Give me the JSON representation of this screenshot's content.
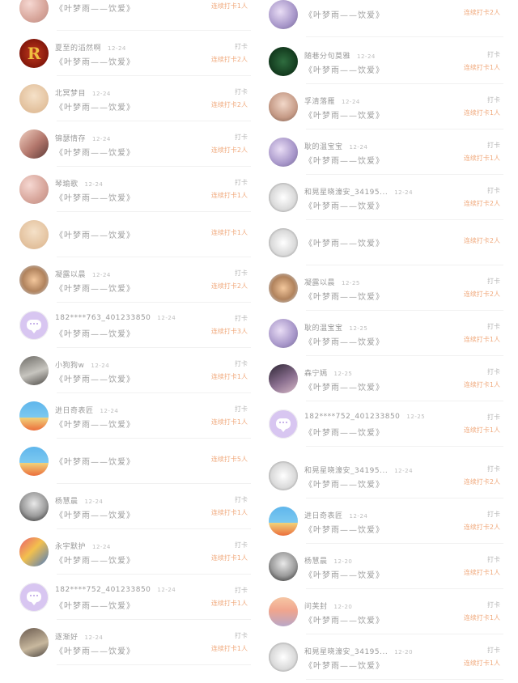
{
  "common": {
    "check_in_label": "打卡"
  },
  "left": [
    {
      "name": "",
      "date": "",
      "title": "《叶梦雨——饮爱》",
      "streak": "连续打卡1人",
      "avatar": "photo-pink",
      "partial": true
    },
    {
      "name": "夏至的滔然啊",
      "date": "12-24",
      "title": "《叶梦雨——饮爱》",
      "streak": "连续打卡2人",
      "avatar": "r-logo"
    },
    {
      "name": "北冥梦目",
      "date": "12-24",
      "title": "《叶梦雨——饮爱》",
      "streak": "连续打卡2人",
      "avatar": "cartoon"
    },
    {
      "name": "锦瑟情存",
      "date": "12-24",
      "title": "《叶梦雨——饮爱》",
      "streak": "连续打卡2人",
      "avatar": "photo-girl"
    },
    {
      "name": "琴瑜歌",
      "date": "12-24",
      "title": "《叶梦雨——饮爱》",
      "streak": "连续打卡1人",
      "avatar": "photo-pink"
    },
    {
      "name": "",
      "date": "",
      "title": "《叶梦雨——饮爱》",
      "streak": "连续打卡1人",
      "avatar": "cartoon",
      "single": true
    },
    {
      "name": "凝露以晨",
      "date": "12-24",
      "title": "《叶梦雨——饮爱》",
      "streak": "连续打卡2人",
      "avatar": "shell"
    },
    {
      "name": "182****763_401233850",
      "date": "12-24",
      "title": "《叶梦雨——饮爱》",
      "streak": "连续打卡3人",
      "avatar": "chat"
    },
    {
      "name": "小狗狗w",
      "date": "12-24",
      "title": "《叶梦雨——饮爱》",
      "streak": "连续打卡1人",
      "avatar": "photo-dog"
    },
    {
      "name": "进日奇表匠",
      "date": "12-24",
      "title": "《叶梦雨——饮爱》",
      "streak": "连续打卡1人",
      "avatar": "poster"
    },
    {
      "name": "",
      "date": "",
      "title": "《叶梦雨——饮爱》",
      "streak": "连续打卡5人",
      "avatar": "poster",
      "single": true
    },
    {
      "name": "杨慧晨",
      "date": "12-24",
      "title": "《叶梦雨——饮爱》",
      "streak": "连续打卡1人",
      "avatar": "bw-face"
    },
    {
      "name": "永宇默护",
      "date": "12-24",
      "title": "《叶梦雨——饮爱》",
      "streak": "连续打卡1人",
      "avatar": "photo-colorful"
    },
    {
      "name": "182****752_401233850",
      "date": "12-24",
      "title": "《叶梦雨——饮爱》",
      "streak": "连续打卡1人",
      "avatar": "chat"
    },
    {
      "name": "逐渐好",
      "date": "12-24",
      "title": "《叶梦雨——饮爱》",
      "streak": "连续打卡1人",
      "avatar": "photo-street"
    }
  ],
  "right": [
    {
      "name": "",
      "date": "",
      "title": "《叶梦雨——饮爱》",
      "streak": "连续打卡2人",
      "avatar": "photo-purple",
      "partial": true
    },
    {
      "name": "随巷分句莫雅",
      "date": "12-24",
      "title": "《叶梦雨——饮爱》",
      "streak": "连续打卡1人",
      "avatar": "green-dark"
    },
    {
      "name": "孚清落雁",
      "date": "12-24",
      "title": "《叶梦雨——饮爱》",
      "streak": "连续打卡1人",
      "avatar": "photo-girl2"
    },
    {
      "name": "耿的温宝宝",
      "date": "12-24",
      "title": "《叶梦雨——饮爱》",
      "streak": "连续打卡1人",
      "avatar": "photo-purple"
    },
    {
      "name": "和晃星晓濠安_34195...",
      "date": "12-24",
      "title": "《叶梦雨——饮爱》",
      "streak": "连续打卡2人",
      "avatar": "sketch"
    },
    {
      "name": "",
      "date": "",
      "title": "《叶梦雨——饮爱》",
      "streak": "连续打卡2人",
      "avatar": "sketch",
      "partial": true
    },
    {
      "name": "凝露以晨",
      "date": "12-25",
      "title": "《叶梦雨——饮爱》",
      "streak": "连续打卡2人",
      "avatar": "shell"
    },
    {
      "name": "耿的温宝宝",
      "date": "12-25",
      "title": "《叶梦雨——饮爱》",
      "streak": "连续打卡1人",
      "avatar": "photo-purple"
    },
    {
      "name": "森宁嫣",
      "date": "12-25",
      "title": "《叶梦雨——饮爱》",
      "streak": "连续打卡1人",
      "avatar": "photo-dark"
    },
    {
      "name": "182****752_401233850",
      "date": "12-25",
      "title": "《叶梦雨——饮爱》",
      "streak": "连续打卡1人",
      "avatar": "chat"
    },
    {
      "name": "和晃星晓濠安_34195...",
      "date": "12-24",
      "title": "《叶梦雨——饮爱》",
      "streak": "连续打卡2人",
      "avatar": "sketch"
    },
    {
      "name": "进日奇表匠",
      "date": "12-24",
      "title": "《叶梦雨——饮爱》",
      "streak": "连续打卡2人",
      "avatar": "poster"
    },
    {
      "name": "杨慧晨",
      "date": "12-20",
      "title": "《叶梦雨——饮爱》",
      "streak": "连续打卡1人",
      "avatar": "bw-face"
    },
    {
      "name": "问芙封",
      "date": "12-20",
      "title": "《叶梦雨——饮爱》",
      "streak": "连续打卡1人",
      "avatar": "sunset"
    },
    {
      "name": "和晃星晓濠安_34195...",
      "date": "12-20",
      "title": "《叶梦雨——饮爱》",
      "streak": "连续打卡1人",
      "avatar": "sketch"
    }
  ]
}
